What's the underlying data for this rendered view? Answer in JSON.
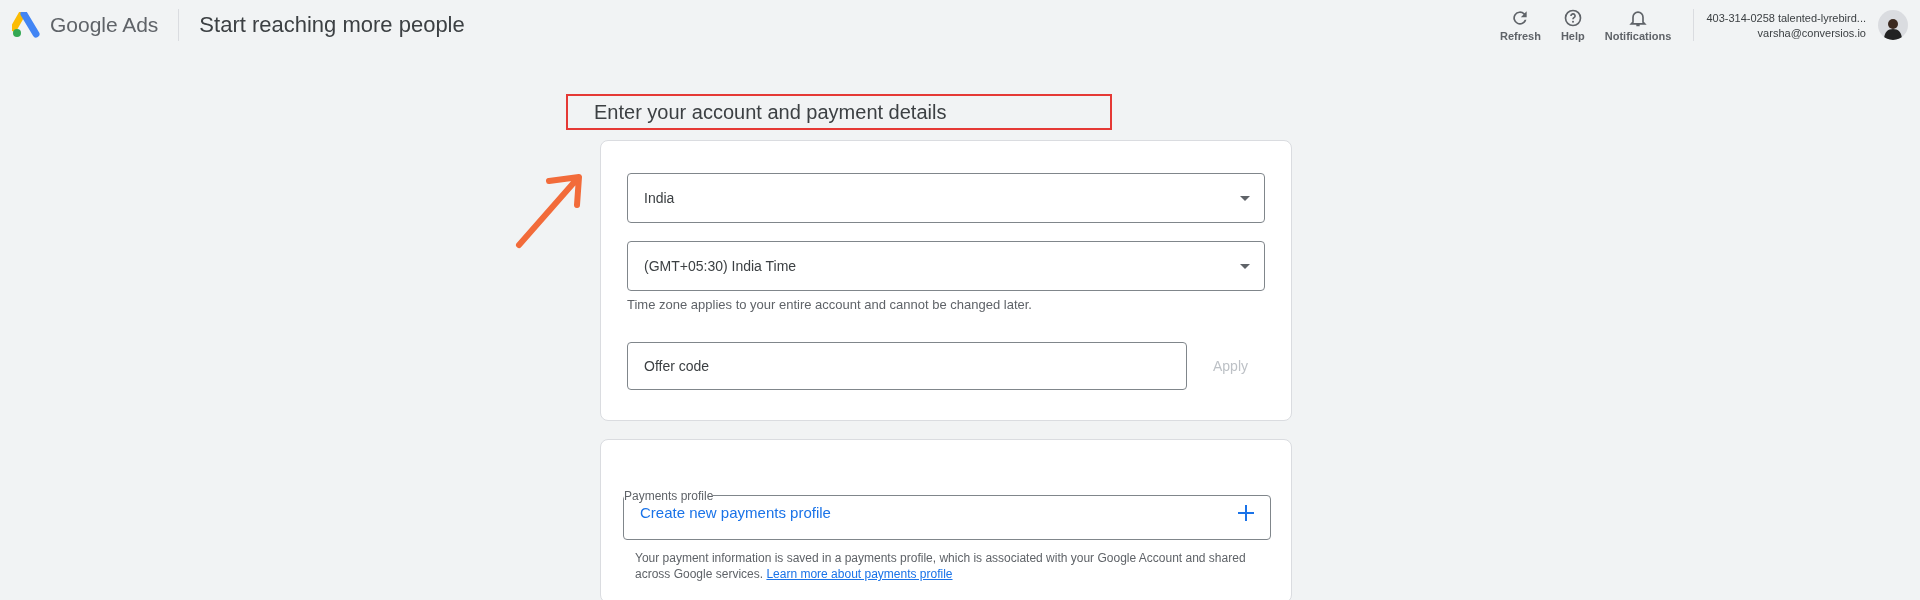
{
  "header": {
    "brand": "Google",
    "product": "Ads",
    "page_title": "Start reaching more people",
    "actions": [
      {
        "kind": "refresh",
        "label": "Refresh"
      },
      {
        "kind": "help",
        "label": "Help"
      },
      {
        "kind": "notifications",
        "label": "Notifications"
      }
    ],
    "account": {
      "id_line": "403-314-0258 talented-lyrebird...",
      "email": "varsha@conversios.io"
    }
  },
  "form": {
    "title": "Enter your account and payment details",
    "country": {
      "value": "India"
    },
    "timezone": {
      "value": "(GMT+05:30) India Time",
      "hint": "Time zone applies to your entire account and cannot be changed later."
    },
    "offer_code": {
      "placeholder": "Offer code",
      "apply_label": "Apply",
      "apply_disabled": true
    }
  },
  "payments": {
    "legend": "Payments profile",
    "action": "Create new payments profile",
    "note": "Your payment information is saved in a payments profile, which is associated with your Google Account and shared across Google services.",
    "link": "Learn more about payments profile"
  }
}
